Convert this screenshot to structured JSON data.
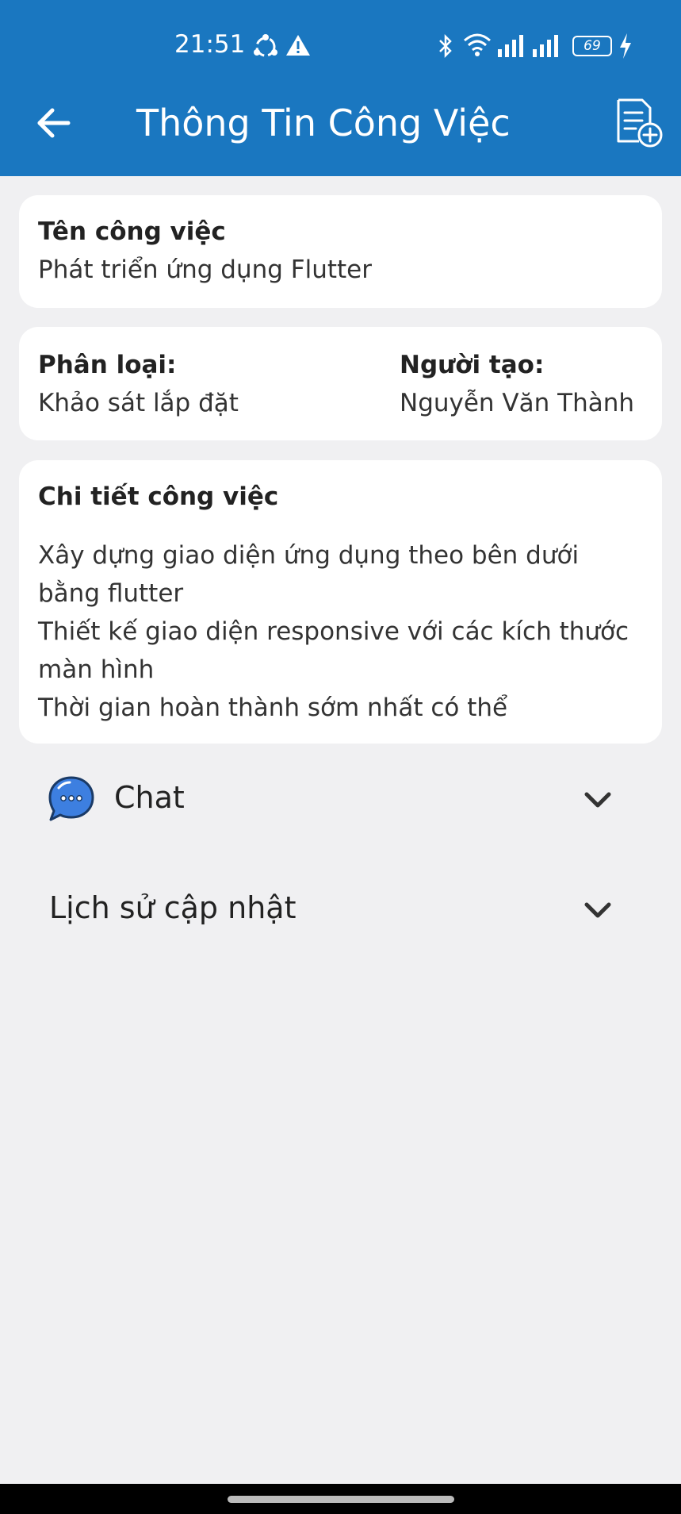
{
  "status_bar": {
    "time": "21:51",
    "battery": "69",
    "icons": [
      "sync-icon",
      "alert-icon",
      "bluetooth-icon",
      "wifi-icon",
      "signal-icon",
      "signal-icon",
      "battery-icon",
      "charging-icon"
    ]
  },
  "app_bar": {
    "title": "Thông Tin Công Việc",
    "back_icon": "arrow-back-icon",
    "action_icon": "document-add-icon",
    "color": "#1a77c0"
  },
  "task_name": {
    "label": "Tên công việc",
    "value": "Phát triển ứng dụng Flutter"
  },
  "meta": {
    "category_label": "Phân loại:",
    "category_value": "Khảo sát lắp đặt",
    "creator_label": "Người tạo:",
    "creator_value": "Nguyễn Văn Thành"
  },
  "details": {
    "label": "Chi tiết công việc",
    "lines": [
      "Xây dựng giao diện ứng dụng theo bên dưới",
      "bằng flutter",
      "Thiết kế giao diện responsive với các kích thước",
      "màn hình",
      "Thời gian hoàn thành sớm nhất có thể"
    ]
  },
  "sections": {
    "chat": {
      "title": "Chat",
      "icon": "chat-bubble-icon"
    },
    "history": {
      "title": "Lịch sử cập nhật"
    }
  }
}
